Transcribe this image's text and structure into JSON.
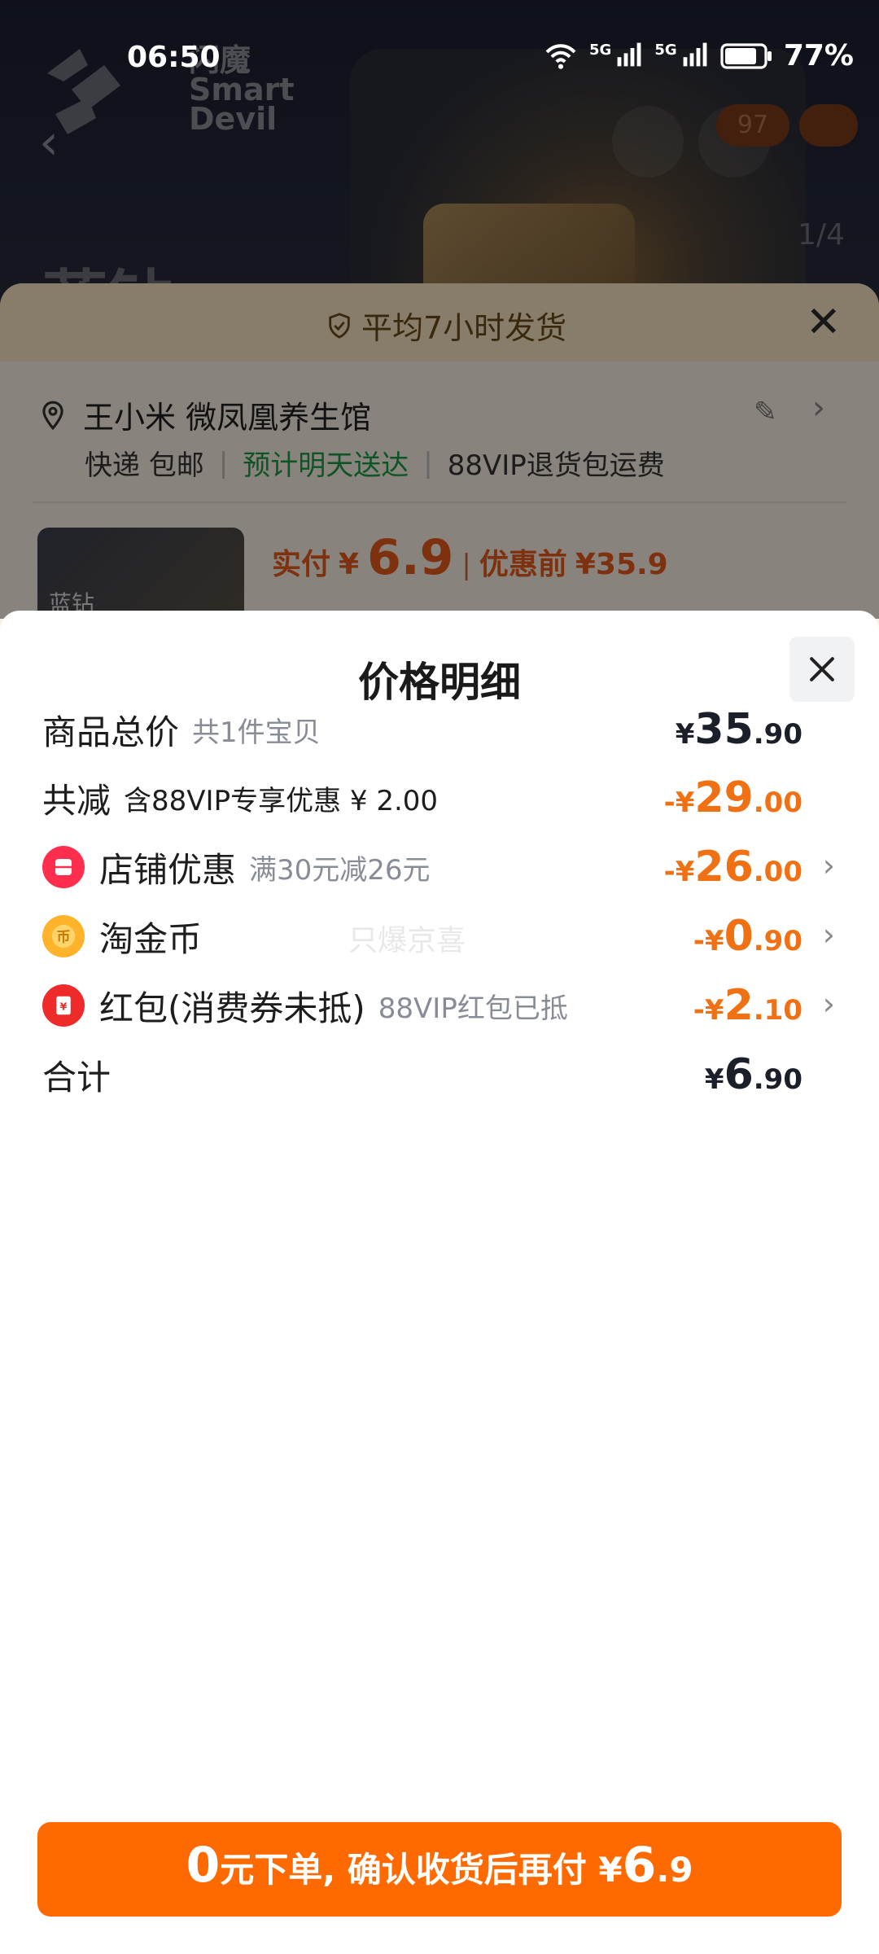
{
  "status_bar": {
    "time": "06:50",
    "battery": "77%",
    "net1": "5G",
    "net2": "5G"
  },
  "background": {
    "brand_line1": "闪魔",
    "brand_line2": "Smart",
    "brand_line3": "Devil",
    "title": "蓝钻",
    "cart_badge": "97",
    "page_indicator": "1/4"
  },
  "order": {
    "ship_banner": "平均7小时发货",
    "address_name": "王小米 微凤凰养生馆",
    "delivery": "快递 包邮",
    "eta": "预计明天送达",
    "vip_return": "88VIP退货包运费",
    "thumb_label": "蓝钻",
    "pay_label": "实付",
    "pay_currency": "¥",
    "pay_value": "6.9",
    "before_label": "优惠前",
    "before_value": "¥35.9"
  },
  "detail": {
    "title": "价格明细",
    "watermark": "只爆京喜",
    "rows": {
      "total": {
        "label": "商品总价",
        "sub": "共1件宝贝",
        "cur": "¥",
        "int": "35",
        "dec": ".90"
      },
      "reduce": {
        "label": "共减",
        "sub": "含88VIP专享优惠 ¥ 2.00",
        "prefix": "-¥",
        "int": "29",
        "dec": ".00"
      },
      "shop": {
        "label": "店铺优惠",
        "sub": "满30元减26元",
        "prefix": "-¥",
        "int": "26",
        "dec": ".00"
      },
      "coin": {
        "label": "淘金币",
        "prefix": "-¥",
        "int": "0",
        "dec": ".90"
      },
      "redpack": {
        "label": "红包(消费券未抵)",
        "sub": "88VIP红包已抵",
        "prefix": "-¥",
        "int": "2",
        "dec": ".10"
      },
      "sum": {
        "label": "合计",
        "cur": "¥",
        "int": "6",
        "dec": ".90"
      }
    }
  },
  "cta": {
    "zero": "0",
    "text1": "元下单, 确认收货后再付 ¥",
    "amount_int": "6",
    "amount_dec": ".9"
  },
  "colors": {
    "accent": "#ff6a00",
    "discount": "#f07014",
    "green": "#1a9a44"
  }
}
